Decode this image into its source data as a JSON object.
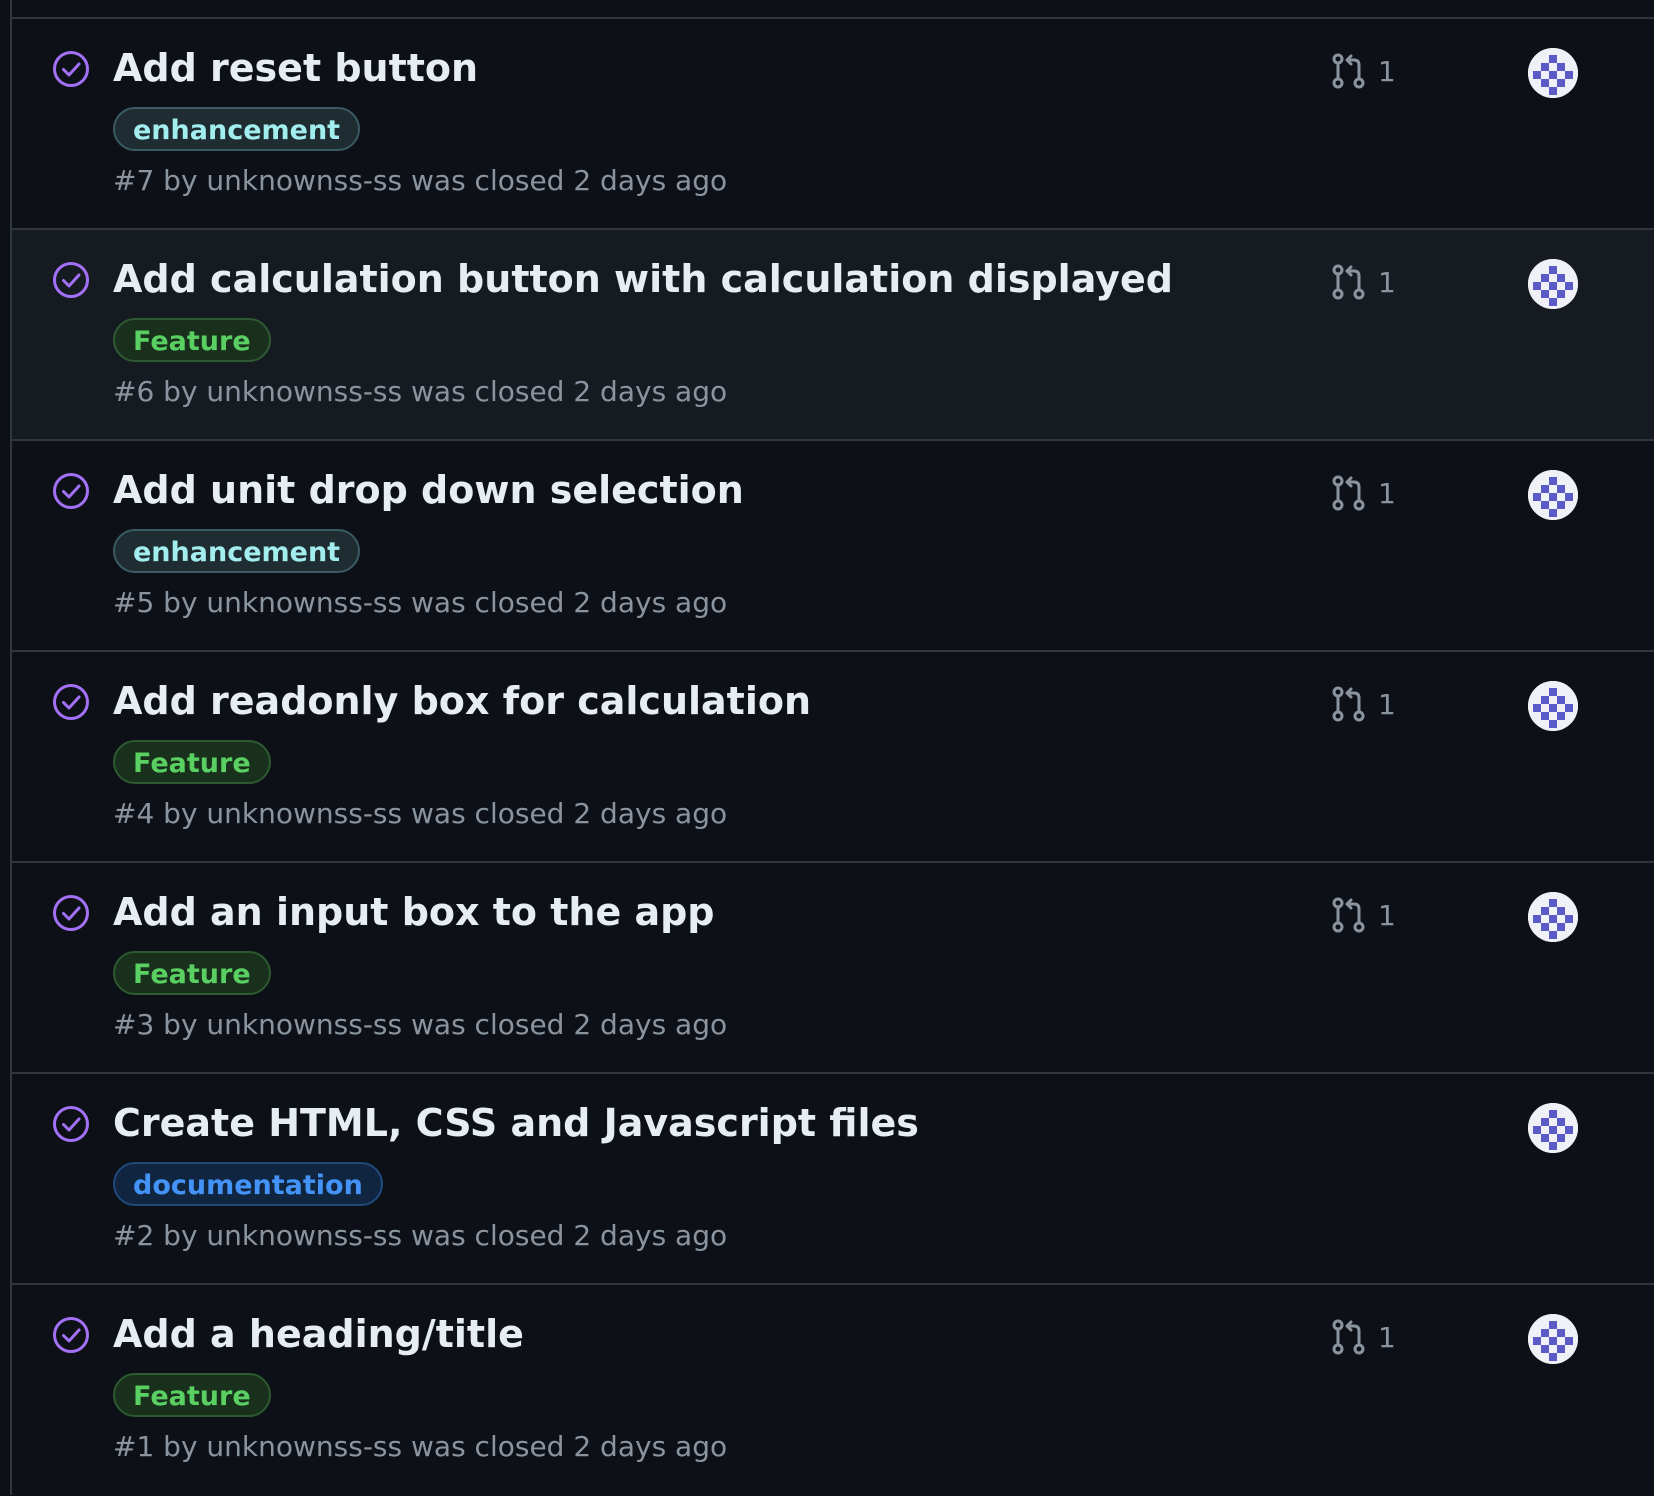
{
  "issues": [
    {
      "title": "Add reset button",
      "label": "enhancement",
      "label_style": "enhancement",
      "meta": "#7 by unknownss-ss was closed 2 days ago",
      "linked_prs": "1",
      "has_pr": true
    },
    {
      "title": "Add calculation button with calculation displayed",
      "label": "Feature",
      "label_style": "feature",
      "meta": "#6 by unknownss-ss was closed 2 days ago",
      "linked_prs": "1",
      "has_pr": true
    },
    {
      "title": "Add unit drop down selection",
      "label": "enhancement",
      "label_style": "enhancement",
      "meta": "#5 by unknownss-ss was closed 2 days ago",
      "linked_prs": "1",
      "has_pr": true
    },
    {
      "title": "Add readonly box for calculation",
      "label": "Feature",
      "label_style": "feature",
      "meta": "#4 by unknownss-ss was closed 2 days ago",
      "linked_prs": "1",
      "has_pr": true
    },
    {
      "title": "Add an input box to the app",
      "label": "Feature",
      "label_style": "feature",
      "meta": "#3 by unknownss-ss was closed 2 days ago",
      "linked_prs": "1",
      "has_pr": true
    },
    {
      "title": "Create HTML, CSS and Javascript files",
      "label": "documentation",
      "label_style": "documentation",
      "meta": "#2 by unknownss-ss was closed 2 days ago",
      "linked_prs": "",
      "has_pr": false
    },
    {
      "title": "Add a heading/title",
      "label": "Feature",
      "label_style": "feature",
      "meta": "#1 by unknownss-ss was closed 2 days ago",
      "linked_prs": "1",
      "has_pr": true
    }
  ],
  "icons": {
    "state": "closed-completed-icon",
    "pull_request": "git-pull-request-icon",
    "avatar": "identicon-avatar"
  },
  "colors": {
    "background": "#0d1117",
    "hover_row": "#161b22",
    "completed_purple": "#a371f7",
    "border": "#30363d",
    "muted_text": "#8b949e"
  }
}
